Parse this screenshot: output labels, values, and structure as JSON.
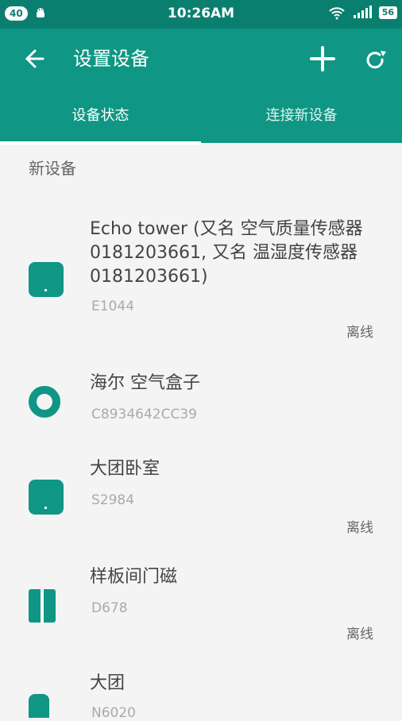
{
  "status_bar": {
    "left_badge": "40",
    "time": "10:26AM",
    "battery": "56"
  },
  "app_bar": {
    "title": "设置设备",
    "tabs": [
      {
        "label": "设备状态"
      },
      {
        "label": "连接新设备"
      }
    ]
  },
  "section": {
    "header": "新设备"
  },
  "devices": [
    {
      "name": "Echo tower (又名 空气质量传感器0181203661, 又名 温湿度传感器0181203661)",
      "id": "E1044",
      "status": "离线"
    },
    {
      "name": "海尔 空气盒子",
      "id": "C8934642CC39",
      "status": ""
    },
    {
      "name": "大团卧室",
      "id": "S2984",
      "status": "离线"
    },
    {
      "name": "样板间门磁",
      "id": "D678",
      "status": "离线"
    },
    {
      "name": "大团",
      "id": "N6020",
      "status": ""
    }
  ],
  "colors": {
    "primary": "#0f9684",
    "status_bar": "#0b7f6f",
    "background": "#f4f4f4"
  }
}
